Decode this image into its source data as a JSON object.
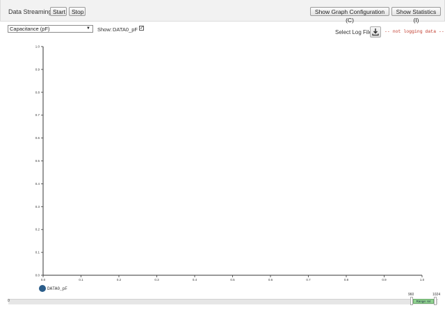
{
  "toolbar": {
    "data_streaming_label": "Data Streaming:",
    "start_label": "Start",
    "stop_label": "Stop",
    "graph_config_label": "Show Graph Configuration (C)",
    "statistics_label": "Show Statistics (I)"
  },
  "controls": {
    "measurement_select": "Capacitance (pF)",
    "show_label": "Show:",
    "series_label": "DATA0_pF",
    "series_checked": true,
    "log_file_label": "Select Log File:",
    "download_icon": "download-icon",
    "log_status": "-- not logging data --"
  },
  "chart_data": {
    "type": "line",
    "x_ticks": [
      "0.0",
      "0.1",
      "0.2",
      "0.3",
      "0.4",
      "0.5",
      "0.6",
      "0.7",
      "0.8",
      "0.9",
      "1.0"
    ],
    "y_ticks": [
      "0.0",
      "0.1",
      "0.2",
      "0.3",
      "0.4",
      "0.5",
      "0.6",
      "0.7",
      "0.8",
      "0.9",
      "1.0"
    ],
    "xlim": [
      0,
      1
    ],
    "ylim": [
      0,
      1
    ],
    "series": [
      {
        "name": "DATA0_pF",
        "values": []
      }
    ],
    "legend_position": "bottom-left",
    "grid": false
  },
  "slider": {
    "min_label": "0",
    "range_min": "960",
    "range_max": "1024",
    "range_label": "Range: 64"
  },
  "colors": {
    "legend_icon": "#2b5d8a",
    "range_bar": "#8fd18f",
    "log_status": "#c0392b"
  }
}
